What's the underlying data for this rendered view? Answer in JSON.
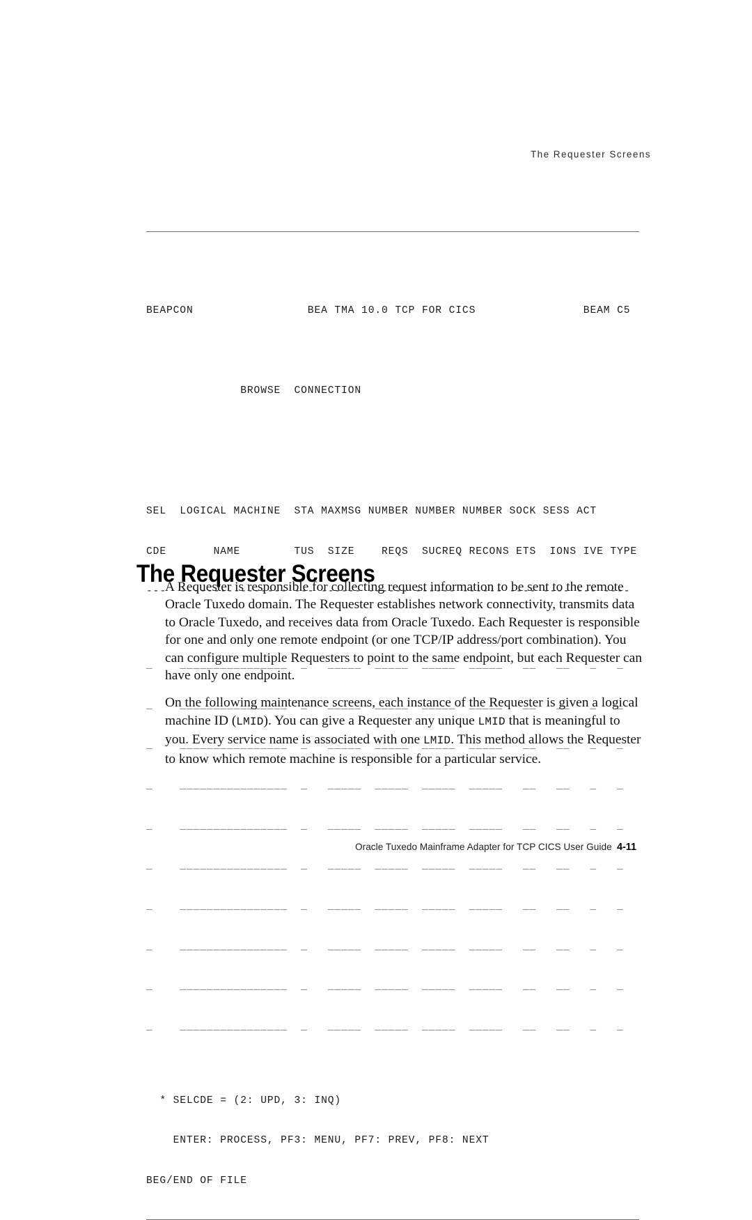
{
  "running_header": "The Requester Screens",
  "terminal_screen": {
    "transaction_id": "BEAPCON",
    "product_title": "BEA TMA 10.0 TCP FOR CICS",
    "screen_id": "BEAM C5",
    "screen_function": "BROWSE  CONNECTION",
    "header_line_1": "SEL  LOGICAL MACHINE  STA MAXMSG NUMBER NUMBER NUMBER SOCK SESS ACT",
    "header_line_2": "CDE       NAME        TUS  SIZE    REQS  SUCREQ RECONS ETS  IONS IVE TYPE",
    "separator_line": "---  ---------------- --- ------ ------ ------ ------ ---- ---- --- ----",
    "data_row": "_    ________________  _   _____  _____  _____  _____   __   __   _   _",
    "data_row_count": 10,
    "columns": [
      {
        "header_top": "SEL",
        "header_bottom": "CDE",
        "width_dashes": 3
      },
      {
        "header_top": "LOGICAL MACHINE",
        "header_bottom": "NAME",
        "width_dashes": 16
      },
      {
        "header_top": "STA",
        "header_bottom": "TUS",
        "width_dashes": 3
      },
      {
        "header_top": "MAXMSG",
        "header_bottom": "SIZE",
        "width_dashes": 6
      },
      {
        "header_top": "NUMBER",
        "header_bottom": "REQS",
        "width_dashes": 6
      },
      {
        "header_top": "NUMBER",
        "header_bottom": "SUCREQ",
        "width_dashes": 6
      },
      {
        "header_top": "NUMBER",
        "header_bottom": "RECONS",
        "width_dashes": 6
      },
      {
        "header_top": "SOCK",
        "header_bottom": "ETS",
        "width_dashes": 4
      },
      {
        "header_top": "SESS",
        "header_bottom": "IONS",
        "width_dashes": 4
      },
      {
        "header_top": "ACT",
        "header_bottom": "IVE",
        "width_dashes": 3
      },
      {
        "header_top": "",
        "header_bottom": "TYPE",
        "width_dashes": 4
      }
    ],
    "footer_selcde": "* SELCDE = (2: UPD, 3: INQ)",
    "footer_keys": "ENTER: PROCESS, PF3: MENU, PF7: PREV, PF8: NEXT",
    "footer_status": "BEG/END OF FILE"
  },
  "section": {
    "heading": "The Requester Screens",
    "paragraph_1": "A Requester is responsible for collecting request information to be sent to the remote Oracle Tuxedo domain. The Requester establishes network connectivity, transmits data to Oracle Tuxedo, and receives data from Oracle Tuxedo. Each Requester is responsible for one and only one remote endpoint (or one TCP/IP address/port combination). You can configure multiple Requesters to point to the same endpoint, but each Requester can have only one endpoint.",
    "paragraph_2_part_1": "On the following maintenance screens, each instance of the Requester is given a logical machine ID (",
    "paragraph_2_mono_1": "LMID",
    "paragraph_2_part_2": "). You can give a Requester any unique ",
    "paragraph_2_mono_2": "LMID",
    "paragraph_2_part_3": " that is meaningful to you. Every service name is associated with one ",
    "paragraph_2_mono_3": "LMID",
    "paragraph_2_part_4": ". This method allows the Requester to know which remote machine is responsible for a particular service."
  },
  "page_footer": {
    "guide_title": "Oracle Tuxedo Mainframe Adapter for TCP CICS User Guide",
    "page_number": "4-11"
  },
  "colors": {
    "rule": "#6d6d6d",
    "terminal_text": "#1a1a1a",
    "body_text": "#111111",
    "header_text": "#2b2b2b"
  }
}
